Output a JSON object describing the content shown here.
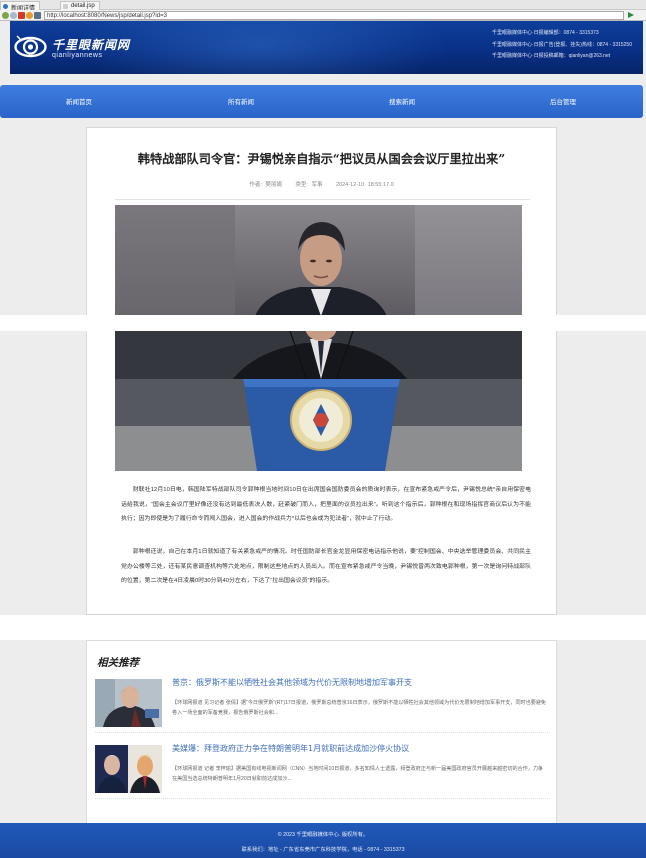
{
  "browser": {
    "tabs": [
      {
        "label": "新闻详情"
      },
      {
        "label": "detail.jsp"
      }
    ],
    "url": "http://localhost:8080/News/jsp/detail.jsp?id=3"
  },
  "header": {
    "logo_cn": "千里眼新闻网",
    "logo_en": "qianliyannews",
    "contact_lines": [
      "千里眼融媒体中心·日报编辑部：0874 - 3315373",
      "千里眼融媒体中心·日报广告(登报、挂失)热线：0874 - 3315250",
      "千里眼融媒体中心·日报投稿邮箱：qianliyan@263.net"
    ],
    "brand_color": "#0a3288"
  },
  "nav": {
    "items": [
      {
        "label": "新闻首页"
      },
      {
        "label": "所有新闻"
      },
      {
        "label": "搜索新闻"
      },
      {
        "label": "后台管理"
      }
    ]
  },
  "article": {
    "title": "韩特战部队司令官：尹锡悦亲自指示“把议员从国会会议厅里拉出来”",
    "author": "作者: 樊丽娟",
    "category": "类型: 军事",
    "datetime": "2024-12-10 18:55:17.0",
    "paragraphs": [
      "财联社12月10日电，韩国陆军特战部队司令郭种根当地时间10日在出席国会国防委员会的质询时表示，在宣布紧急戒严令后，尹锡悦总统*亲自用保密电话给我说，“国会主会议厅里好像还没有达到最低表决人数，赶紧破门而入，把里面的议员拉出来”。听到这个指示后，郭种根在和现场指挥官商议后认为不能执行；因为即使是为了履行命令而闯入国会，进入国会的作战兵力*以后也会成为犯法者”，就中止了行动。",
      "郭种根还说，自己在本月1日就知道了有关紧急戒严的情况。时任国防部长官金龙显用保密电话指示他说，要“控制国会、中央选举管理委员会、共同民主党办公楼等三处，还有某民意调查机构等六处地点，限制这些地点的人员出入。而在宣布紧急戒严令当晚，尹锡悦曾两次致电郭种根，第一次是询问特战部队的位置，第二次是在4日凌晨0时30分到40分左右，下达了“拉出国会议员”的指示。"
    ],
    "podium_seal_text": "대한민국 대통령"
  },
  "related": {
    "title": "相关推荐",
    "items": [
      {
        "headline": "普京：俄罗斯不能以牺牲社会其他领域为代价无限制地增加军事开支",
        "desc": "【环球网报道 见习记者 张倩】据“今日俄罗斯”(RT)17日报道，俄罗斯总统普京16日表示，俄罗斯不能以牺牲社会其他领域为代价无限制地增加军事开支，同时也要避免卷入一场全面的军备竞赛，报告俄罗斯社会和..."
      },
      {
        "headline": "美媒爆：拜登政府正力争在特朗普明年1月就职前达成加沙停火协议",
        "desc": "【环球网报道 记者 李梓瑜】据美国有线电视新闻网（CNN）当地时间10日报道，多名知情人士透露，拜登政府正与新一届美国政府官员开展越来越密切的合作，力争在美国当选总统特朗普明年1月20日就职前达成加沙..."
      }
    ]
  },
  "footer": {
    "copyright": "© 2023 千里眼融媒体中心. 版权所有。",
    "contact": "联系我们：地址 - 广东省东莞市广东科技学院，电话 - 0874 - 3315373"
  }
}
